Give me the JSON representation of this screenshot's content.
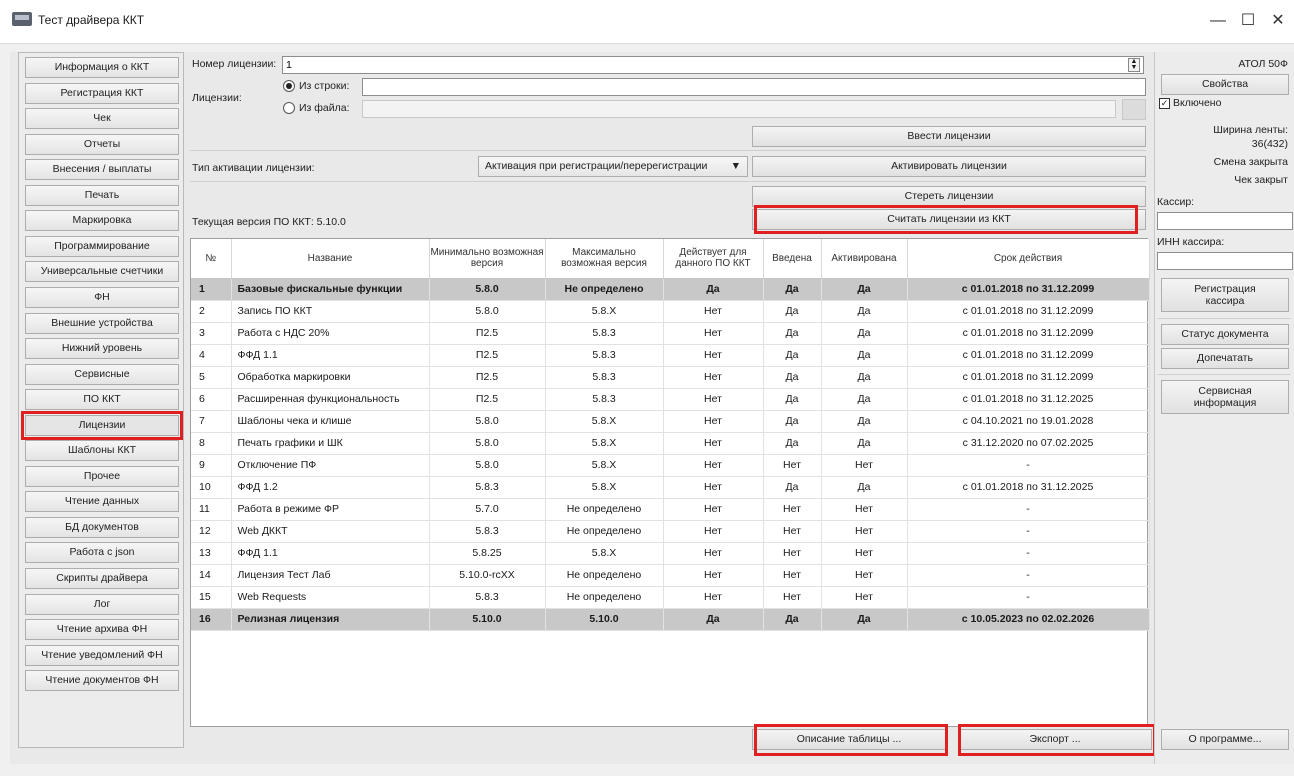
{
  "window": {
    "title": "Тест драйвера ККТ",
    "minimize": "—",
    "maximize": "☐",
    "close": "✕"
  },
  "nav": {
    "items": [
      {
        "label": "Информация о ККТ",
        "active": false
      },
      {
        "label": "Регистрация ККТ",
        "active": false
      },
      {
        "label": "Чек",
        "active": false
      },
      {
        "label": "Отчеты",
        "active": false
      },
      {
        "label": "Внесения / выплаты",
        "active": false
      },
      {
        "label": "Печать",
        "active": false
      },
      {
        "label": "Маркировка",
        "active": false
      },
      {
        "label": "Программирование",
        "active": false
      },
      {
        "label": "Универсальные счетчики",
        "active": false
      },
      {
        "label": "ФН",
        "active": false
      },
      {
        "label": "Внешние устройства",
        "active": false
      },
      {
        "label": "Нижний уровень",
        "active": false
      },
      {
        "label": "Сервисные",
        "active": false
      },
      {
        "label": "ПО ККТ",
        "active": false
      },
      {
        "label": "Лицензии",
        "active": true
      },
      {
        "label": "Шаблоны ККТ",
        "active": false
      },
      {
        "label": "Прочее",
        "active": false
      },
      {
        "label": "Чтение данных",
        "active": false
      },
      {
        "label": "БД документов",
        "active": false
      },
      {
        "label": "Работа с json",
        "active": false
      },
      {
        "label": "Скрипты драйвера",
        "active": false
      },
      {
        "label": "Лог",
        "active": false
      },
      {
        "label": "Чтение архива ФН",
        "active": false
      },
      {
        "label": "Чтение уведомлений ФН",
        "active": false
      },
      {
        "label": "Чтение документов ФН",
        "active": false
      }
    ]
  },
  "license": {
    "number_label": "Номер лицензии:",
    "number_value": "1",
    "licenses_label": "Лицензии:",
    "from_string_label": "Из строки:",
    "from_file_label": "Из файла:",
    "from_string_value": "",
    "from_file_value": "",
    "enter_button": "Ввести лицензии",
    "activation_type_label": "Тип активации лицензии:",
    "activation_type_value": "Активация при регистрации/перерегистрации",
    "activate_button": "Активировать лицензии",
    "erase_button": "Стереть лицензии",
    "read_button": "Считать лицензии из ККТ",
    "current_version": "Текущая версия ПО ККТ: 5.10.0",
    "describe_button": "Описание таблицы ...",
    "export_button": "Экспорт ..."
  },
  "table": {
    "columns": [
      "№",
      "Название",
      "Минимально возможная версия",
      "Максимально возможная версия",
      "Действует для данного ПО ККТ",
      "Введена",
      "Активирована",
      "Срок действия"
    ],
    "rows": [
      {
        "bold": true,
        "cells": [
          "1",
          "Базовые фискальные функции",
          "5.8.0",
          "Не определено",
          "Да",
          "Да",
          "Да",
          "с 01.01.2018 по 31.12.2099"
        ]
      },
      {
        "bold": false,
        "cells": [
          "2",
          "Запись ПО ККТ",
          "5.8.0",
          "5.8.X",
          "Нет",
          "Да",
          "Да",
          "с 01.01.2018 по 31.12.2099"
        ]
      },
      {
        "bold": false,
        "cells": [
          "3",
          "Работа с НДС 20%",
          "П2.5",
          "5.8.3",
          "Нет",
          "Да",
          "Да",
          "с 01.01.2018 по 31.12.2099"
        ]
      },
      {
        "bold": false,
        "cells": [
          "4",
          "ФФД 1.1",
          "П2.5",
          "5.8.3",
          "Нет",
          "Да",
          "Да",
          "с 01.01.2018 по 31.12.2099"
        ]
      },
      {
        "bold": false,
        "cells": [
          "5",
          "Обработка маркировки",
          "П2.5",
          "5.8.3",
          "Нет",
          "Да",
          "Да",
          "с 01.01.2018 по 31.12.2099"
        ]
      },
      {
        "bold": false,
        "cells": [
          "6",
          "Расширенная функциональность",
          "П2.5",
          "5.8.3",
          "Нет",
          "Да",
          "Да",
          "с 01.01.2018 по 31.12.2025"
        ]
      },
      {
        "bold": false,
        "cells": [
          "7",
          "Шаблоны чека и клише",
          "5.8.0",
          "5.8.X",
          "Нет",
          "Да",
          "Да",
          "с 04.10.2021 по 19.01.2028"
        ]
      },
      {
        "bold": false,
        "cells": [
          "8",
          "Печать графики и ШК",
          "5.8.0",
          "5.8.X",
          "Нет",
          "Да",
          "Да",
          "с 31.12.2020 по 07.02.2025"
        ]
      },
      {
        "bold": false,
        "cells": [
          "9",
          "Отключение ПФ",
          "5.8.0",
          "5.8.X",
          "Нет",
          "Нет",
          "Нет",
          "-"
        ]
      },
      {
        "bold": false,
        "cells": [
          "10",
          "ФФД 1.2",
          "5.8.3",
          "5.8.X",
          "Нет",
          "Да",
          "Да",
          "с 01.01.2018 по 31.12.2025"
        ]
      },
      {
        "bold": false,
        "cells": [
          "11",
          "Работа в режиме ФР",
          "5.7.0",
          "Не определено",
          "Нет",
          "Нет",
          "Нет",
          "-"
        ]
      },
      {
        "bold": false,
        "cells": [
          "12",
          "Web ДККТ",
          "5.8.3",
          "Не определено",
          "Нет",
          "Нет",
          "Нет",
          "-"
        ]
      },
      {
        "bold": false,
        "cells": [
          "13",
          "ФФД 1.1",
          "5.8.25",
          "5.8.X",
          "Нет",
          "Нет",
          "Нет",
          "-"
        ]
      },
      {
        "bold": false,
        "cells": [
          "14",
          "Лицензия Тест Лаб",
          "5.10.0-rcXX",
          "Не определено",
          "Нет",
          "Нет",
          "Нет",
          "-"
        ]
      },
      {
        "bold": false,
        "cells": [
          "15",
          "Web Requests",
          "5.8.3",
          "Не определено",
          "Нет",
          "Нет",
          "Нет",
          "-"
        ]
      },
      {
        "bold": true,
        "cells": [
          "16",
          "Релизная лицензия",
          "5.10.0",
          "5.10.0",
          "Да",
          "Да",
          "Да",
          "с 10.05.2023 по 02.02.2026"
        ]
      }
    ]
  },
  "right": {
    "model": "АТОЛ 50Ф",
    "properties_button": "Свойства",
    "enabled_label": "Включено",
    "enabled_mark": "✓",
    "tape_width_label": "Ширина ленты:",
    "tape_width_value": "36(432)",
    "shift_status": "Смена закрыта",
    "receipt_status": "Чек закрыт",
    "cashier_label": "Кассир:",
    "cashier_value": "",
    "cashier_inn_label": "ИНН кассира:",
    "cashier_inn_value": "",
    "register_cashier_line1": "Регистрация",
    "register_cashier_line2": "кассира",
    "doc_status_button": "Статус документа",
    "reprint_button": "Допечатать",
    "service_info_line1": "Сервисная",
    "service_info_line2": "информация",
    "about_button": "О программе..."
  },
  "highlight_color": "#e02020"
}
